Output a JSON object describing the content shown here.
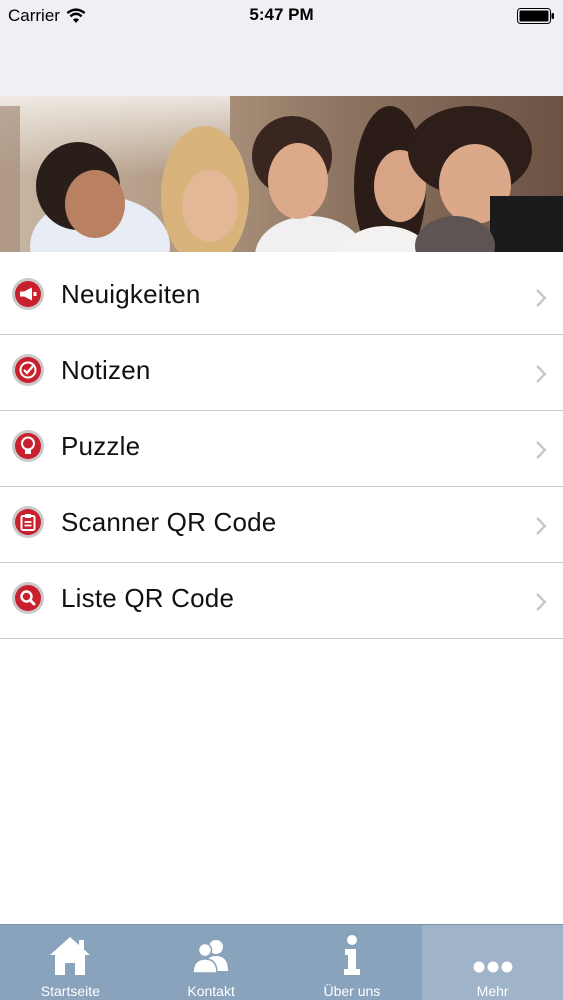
{
  "status_bar": {
    "carrier": "Carrier",
    "time": "5:47 PM",
    "wifi_icon": "wifi-icon",
    "battery_icon": "battery-icon"
  },
  "banner": {
    "image_icon": "students-photo"
  },
  "menu": {
    "items": [
      {
        "label": "Neuigkeiten",
        "icon": "megaphone-icon"
      },
      {
        "label": "Notizen",
        "icon": "checkmark-icon"
      },
      {
        "label": "Puzzle",
        "icon": "lightbulb-icon"
      },
      {
        "label": "Scanner QR Code",
        "icon": "clipboard-icon"
      },
      {
        "label": "Liste QR Code",
        "icon": "magnifier-icon"
      }
    ]
  },
  "tab_bar": {
    "tabs": [
      {
        "label": "Startseite",
        "icon": "home-icon"
      },
      {
        "label": "Kontakt",
        "icon": "people-icon"
      },
      {
        "label": "Über uns",
        "icon": "info-icon"
      },
      {
        "label": "Mehr",
        "icon": "more-icon"
      }
    ],
    "active_index": 3
  },
  "colors": {
    "accent_red": "#c8202c",
    "tab_bar": "#8aa3bd",
    "tab_active": "#9fb3c9",
    "bar_background": "#efeff4"
  }
}
